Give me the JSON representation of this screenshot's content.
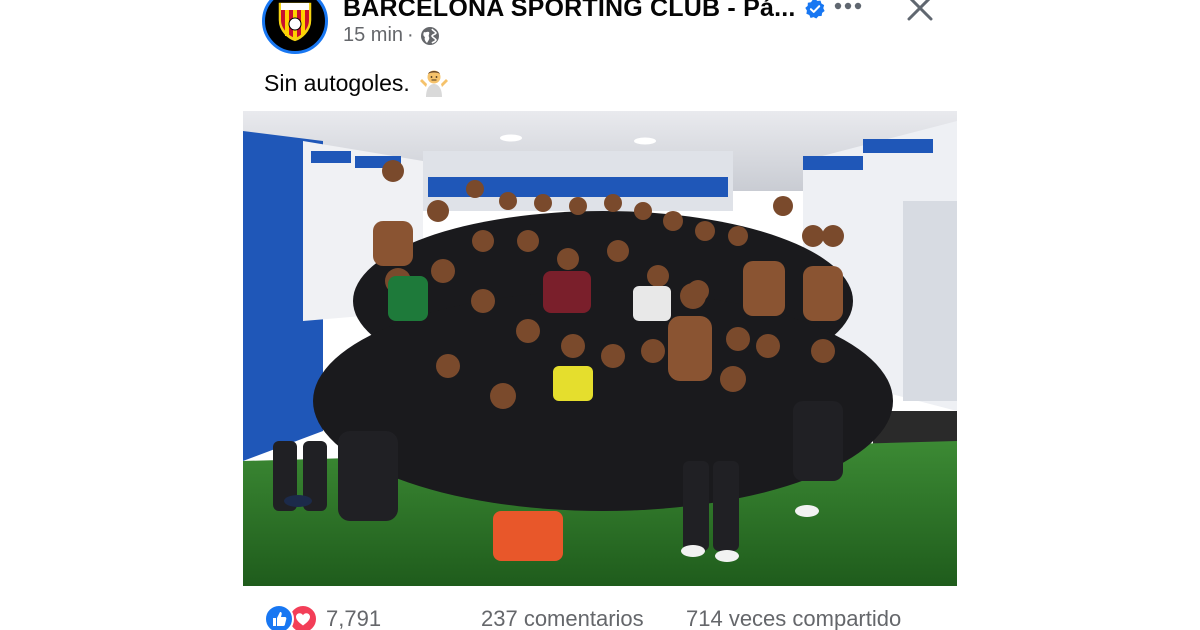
{
  "header": {
    "page_name": "BARCELONA SPORTING CLUB - Pá...",
    "timestamp": "15 min",
    "separator": "·",
    "audience_icon": "globe-icon",
    "verified_icon": "verified-badge-icon",
    "more_icon": "more-options-icon",
    "close_icon": "close-icon",
    "avatar_icon": "bsc-crest-logo"
  },
  "post": {
    "caption": "Sin autogoles.",
    "caption_emoji": "person-shrugging-emoji",
    "photo": "team-celebration-locker-room-photo"
  },
  "footer": {
    "reaction_icons": [
      "like-icon",
      "love-icon"
    ],
    "reaction_count": "7,791",
    "comments": "237 comentarios",
    "shares": "714 veces compartido"
  },
  "colors": {
    "accent": "#1877f2",
    "love": "#f33e58",
    "secondary_text": "#65676b",
    "primary_text": "#050505",
    "turf": "#2f7a2a",
    "locker_blue": "#1f57b8"
  }
}
